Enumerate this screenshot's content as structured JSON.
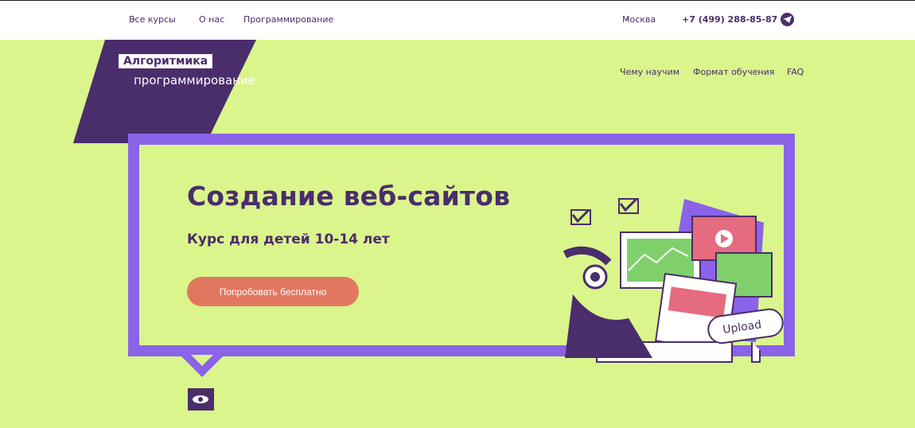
{
  "topbar": {
    "nav": [
      "Все курсы",
      "О нас",
      "Программирование"
    ],
    "city": "Москва",
    "phone": "+7 (499) 288-85-87",
    "telegram_icon": "telegram-icon"
  },
  "logo": {
    "line1": "Алгоритмика",
    "line2": "программирование"
  },
  "subnav": [
    "Чему научим",
    "Формат обучения",
    "FAQ"
  ],
  "hero": {
    "title": "Создание веб-сайтов",
    "subtitle": "Курс для детей 10-14 лет",
    "cta": "Попробовать бесплатно",
    "upload_label": "Upload"
  },
  "colors": {
    "bg": "#d9f58c",
    "purple": "#4a2d6b",
    "frame": "#8a63e8",
    "cta": "#e2775f"
  }
}
